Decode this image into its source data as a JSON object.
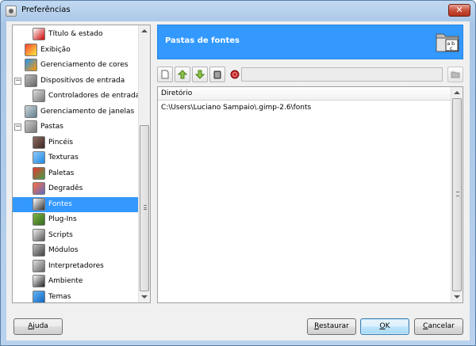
{
  "window": {
    "title": "Preferências",
    "close_glyph": "✕"
  },
  "tree": {
    "items": [
      {
        "label": "Título & estado",
        "icon": "title-icon",
        "level": 2,
        "selected": false
      },
      {
        "label": "Exibição",
        "icon": "display-icon",
        "level": 1,
        "selected": false
      },
      {
        "label": "Gerenciamento de cores",
        "icon": "color-management-icon",
        "level": 1,
        "selected": false
      },
      {
        "label": "Dispositivos de entrada",
        "icon": "input-devices-icon",
        "level": 1,
        "expander": "−",
        "selected": false
      },
      {
        "label": "Controladores de entrada",
        "icon": "input-controllers-icon",
        "level": 2,
        "selected": false
      },
      {
        "label": "Gerenciamento de janelas",
        "icon": "window-management-icon",
        "level": 1,
        "selected": false
      },
      {
        "label": "Pastas",
        "icon": "folders-icon",
        "level": 1,
        "expander": "−",
        "selected": false
      },
      {
        "label": "Pincéis",
        "icon": "brushes-icon",
        "level": 2,
        "selected": false
      },
      {
        "label": "Texturas",
        "icon": "patterns-icon",
        "level": 2,
        "selected": false
      },
      {
        "label": "Paletas",
        "icon": "palettes-icon",
        "level": 2,
        "selected": false
      },
      {
        "label": "Degradês",
        "icon": "gradients-icon",
        "level": 2,
        "selected": false
      },
      {
        "label": "Fontes",
        "icon": "fonts-icon",
        "level": 2,
        "selected": true
      },
      {
        "label": "Plug-Ins",
        "icon": "plugins-icon",
        "level": 2,
        "selected": false
      },
      {
        "label": "Scripts",
        "icon": "scripts-icon",
        "level": 2,
        "selected": false
      },
      {
        "label": "Módulos",
        "icon": "modules-icon",
        "level": 2,
        "selected": false
      },
      {
        "label": "Interpretadores",
        "icon": "interpreters-icon",
        "level": 2,
        "selected": false
      },
      {
        "label": "Ambiente",
        "icon": "environment-icon",
        "level": 2,
        "selected": false
      },
      {
        "label": "Temas",
        "icon": "themes-icon",
        "level": 2,
        "selected": false
      }
    ]
  },
  "panel": {
    "title": "Pastas de fontes",
    "icon": "font-folder-icon",
    "icon_text": "a b c"
  },
  "toolbar": {
    "buttons": [
      "new-folder-icon",
      "move-up-icon",
      "move-down-icon",
      "delete-icon",
      "stop-icon"
    ],
    "path_value": ""
  },
  "list": {
    "header": "Diretório",
    "rows": [
      "C:\\Users\\Luciano Sampaio\\.gimp-2.6\\fonts"
    ]
  },
  "buttons": {
    "help": {
      "pre": "",
      "mnemonic": "A",
      "post": "juda"
    },
    "reset": {
      "pre": "",
      "mnemonic": "R",
      "post": "estaurar"
    },
    "ok": {
      "pre": "",
      "mnemonic": "O",
      "post": "K"
    },
    "cancel": {
      "pre": "",
      "mnemonic": "C",
      "post": "ancelar"
    }
  },
  "colors": {
    "selection": "#3399ff",
    "banner": "#3399ff"
  }
}
